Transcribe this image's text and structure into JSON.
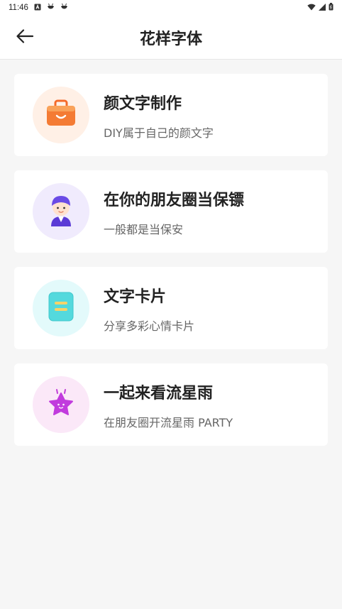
{
  "status_bar": {
    "time": "11:46",
    "icons": [
      "notification-a-icon",
      "bug-icon",
      "bug-icon",
      "wifi-icon",
      "signal-icon",
      "battery-icon"
    ]
  },
  "header": {
    "title": "花样字体",
    "back_icon": "arrow-left-icon"
  },
  "cards": [
    {
      "title": "颜文字制作",
      "desc": "DIY属于自己的颜文字",
      "icon": "bag-icon",
      "icon_bg": "#fff0e6"
    },
    {
      "title": "在你的朋友圈当保镖",
      "desc": "一般都是当保安",
      "icon": "guard-avatar-icon",
      "icon_bg": "#f0ebfd"
    },
    {
      "title": "文字卡片",
      "desc": "分享多彩心情卡片",
      "icon": "card-icon",
      "icon_bg": "#e3fafb"
    },
    {
      "title": "一起来看流星雨",
      "desc": "在朋友圈开流星雨 PARTY",
      "icon": "star-icon",
      "icon_bg": "#fbe8f8"
    }
  ]
}
